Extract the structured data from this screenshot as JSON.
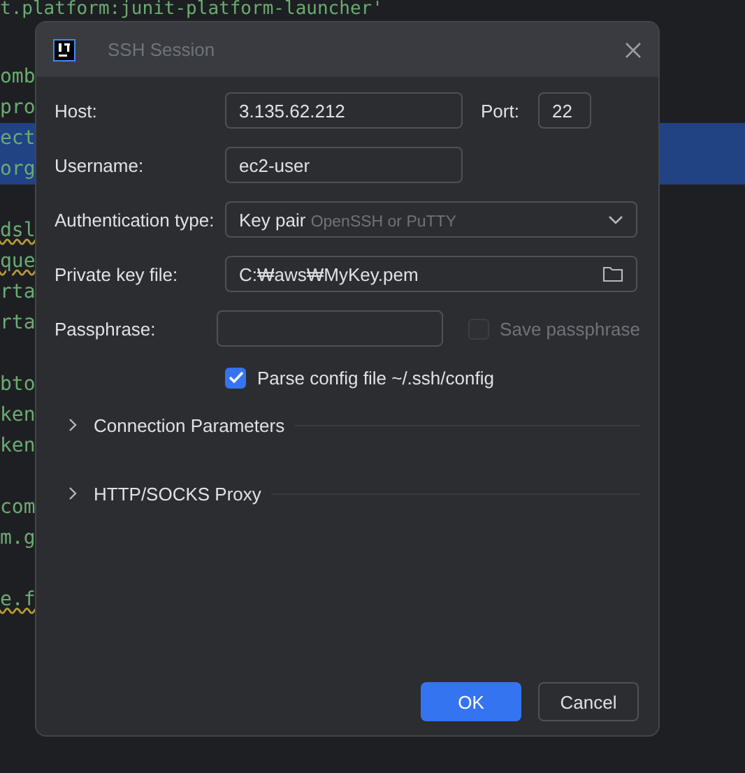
{
  "editor": {
    "blocks": [
      {
        "lines": [
          {
            "text": "t.platform:junit-platform-launcher'",
            "selected": false,
            "warning": false
          }
        ]
      },
      {
        "lines": [
          {
            "text": "omb",
            "selected": false,
            "warning": false
          },
          {
            "text": "pro",
            "selected": false,
            "warning": false
          },
          {
            "text": "ect",
            "selected": true,
            "warning": false
          },
          {
            "text": "org",
            "selected": true,
            "warning": false
          }
        ]
      },
      {
        "lines": [
          {
            "text": "dsl",
            "selected": false,
            "warning": true
          },
          {
            "text": "que",
            "selected": false,
            "warning": true
          },
          {
            "text": "rta",
            "selected": false,
            "warning": false
          },
          {
            "text": "rta",
            "selected": false,
            "warning": false
          }
        ]
      },
      {
        "lines": [
          {
            "text": "bto",
            "selected": false,
            "warning": false
          },
          {
            "text": "ken",
            "selected": false,
            "warning": false
          },
          {
            "text": "ken",
            "selected": false,
            "warning": false
          }
        ]
      },
      {
        "lines": [
          {
            "text": "com",
            "selected": false,
            "warning": false
          },
          {
            "text": "m.g",
            "selected": false,
            "warning": false
          }
        ]
      },
      {
        "lines": [
          {
            "text": "e.f",
            "selected": false,
            "warning": true
          }
        ]
      }
    ]
  },
  "dialog": {
    "title": "SSH Session",
    "host": {
      "label": "Host:",
      "value": "3.135.62.212"
    },
    "port": {
      "label": "Port:",
      "value": "22"
    },
    "username": {
      "label": "Username:",
      "value": "ec2-user"
    },
    "auth_type": {
      "label": "Authentication type:",
      "value": "Key pair",
      "hint": "OpenSSH or PuTTY"
    },
    "private_key": {
      "label": "Private key file:",
      "value": "C:₩aws₩MyKey.pem"
    },
    "passphrase": {
      "label": "Passphrase:",
      "save_label": "Save passphrase",
      "save_checked": false,
      "save_disabled": true
    },
    "parse_config": {
      "label": "Parse config file ~/.ssh/config",
      "checked": true
    },
    "sections": [
      {
        "label": "Connection Parameters",
        "expanded": false
      },
      {
        "label": "HTTP/SOCKS Proxy",
        "expanded": false
      }
    ],
    "buttons": [
      {
        "label": "OK",
        "kind": "primary"
      },
      {
        "label": "Cancel",
        "kind": "secondary"
      }
    ]
  }
}
